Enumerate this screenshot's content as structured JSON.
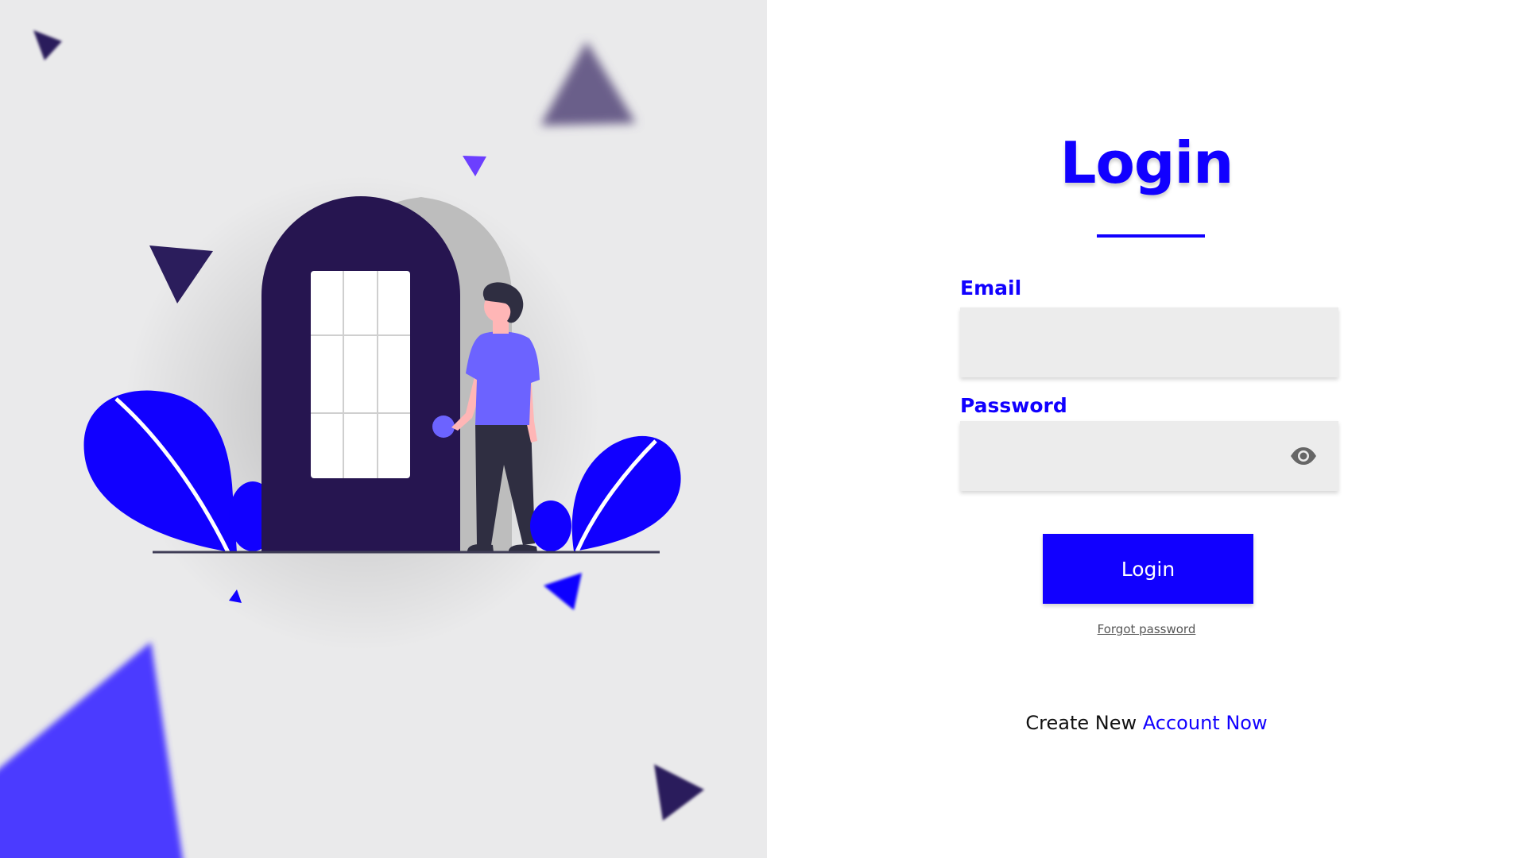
{
  "colors": {
    "accent": "#1100ff",
    "left_background": "#eaeaeb",
    "door": "#261550",
    "door_shadow": "#bdbdbd",
    "shirt": "#6c63ff",
    "pants": "#2f2e41",
    "skin": "#ffb6b6",
    "hair": "#2f2e41",
    "triangle_dark": "#2b1d5c",
    "triangle_purple": "#6c3fff",
    "triangle_blur": "#4b3aff",
    "input_bg": "#ececec"
  },
  "illustration": {
    "icon_names": [
      "door-icon",
      "person-icon",
      "leaf-icon",
      "triangle-icon"
    ]
  },
  "login": {
    "title": "Login",
    "email_label": "Email",
    "email_value": "",
    "password_label": "Password",
    "password_value": "",
    "password_toggle_icon": "eye-icon",
    "submit_label": "Login",
    "forgot_label": "Forgot password",
    "create_prefix": "Create New",
    "create_link": "Account Now"
  }
}
